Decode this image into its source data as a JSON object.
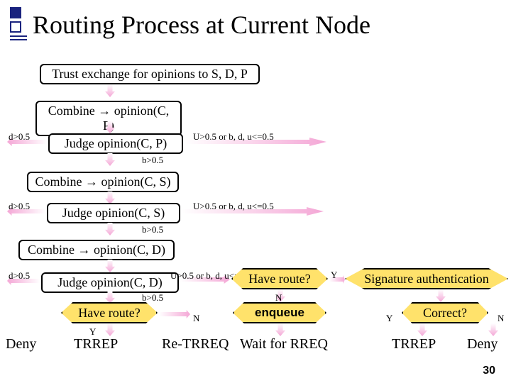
{
  "title": "Routing Process at Current Node",
  "boxes": {
    "trust": "Trust exchange for opinions to S, D, P",
    "combP": "Combine → opinion(C, P)",
    "judgeP": "Judge opinion(C, P)",
    "combS": "Combine → opinion(C, S)",
    "judgeS": "Judge opinion(C, S)",
    "combD": "Combine → opinion(C, D)",
    "judgeD": "Judge opinion(C, D)"
  },
  "labels": {
    "d": "d>0.5",
    "u": "U>0.5 or b, d, u<=0.5",
    "b": "b>0.5",
    "N": "N",
    "Y": "Y"
  },
  "decisions": {
    "route": "Have route?",
    "sig": "Signature authentication",
    "correct": "Correct?",
    "enqueue": "enqueue"
  },
  "terminals": {
    "deny": "Deny",
    "trrep": "TRREP",
    "retrreq": "Re-TRREQ",
    "wait": "Wait for RREQ"
  },
  "page": "30"
}
